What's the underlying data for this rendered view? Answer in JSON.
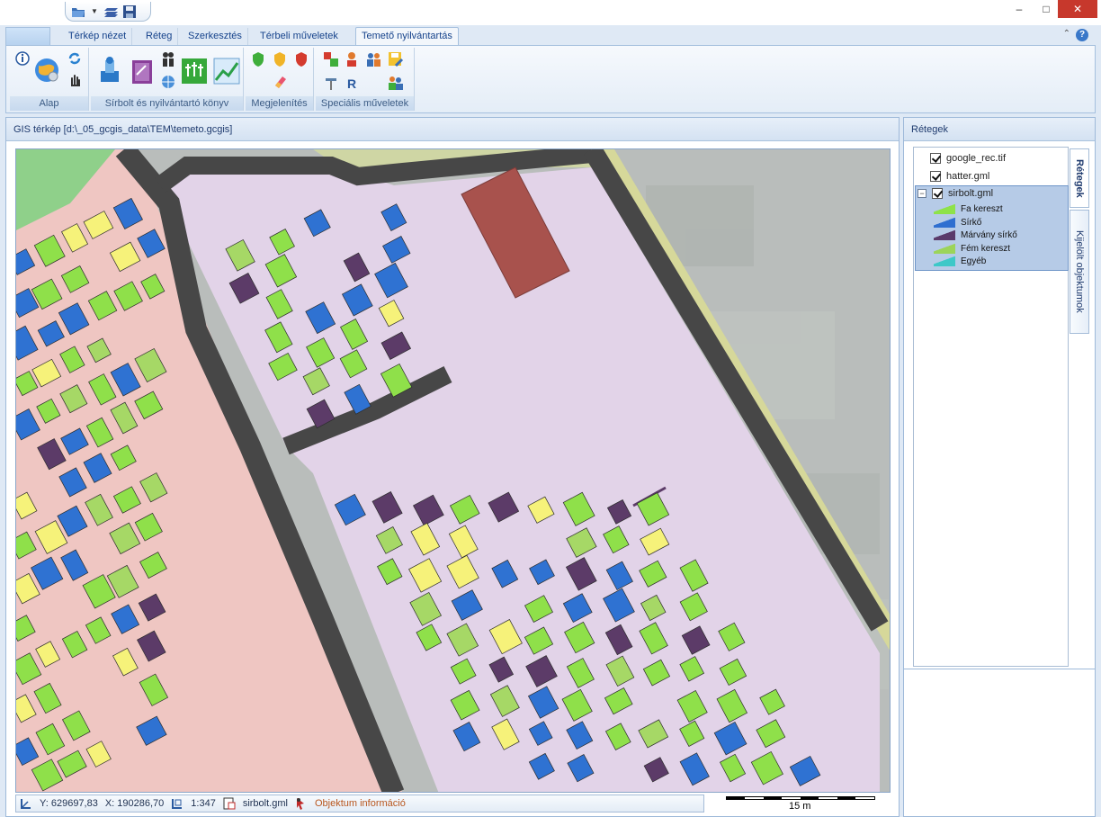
{
  "window": {
    "minimize": "–",
    "maximize": "□",
    "close": "✕"
  },
  "ribbon_tabs": [
    {
      "label": "Térkép nézet"
    },
    {
      "label": "Réteg"
    },
    {
      "label": "Szerkesztés"
    },
    {
      "label": "Térbeli műveletek"
    },
    {
      "label": "Temető nyilvántartás",
      "active": true
    }
  ],
  "ribbon_groups": [
    {
      "label": "Alap"
    },
    {
      "label": "Sírbolt és nyilvántartó könyv"
    },
    {
      "label": "Megjelenítés"
    },
    {
      "label": "Speciális műveletek"
    }
  ],
  "map_panel": {
    "title": "GIS térkép [d:\\_05_gcgis_data\\TEM\\temeto.gcgis]"
  },
  "status": {
    "y": "Y: 629697,83",
    "x": "X: 190286,70",
    "scale": "1:347",
    "layer": "sirbolt.gml",
    "tool": "Objektum információ"
  },
  "scalebar": {
    "label": "15 m"
  },
  "layers_panel": {
    "title": "Rétegek",
    "tab_layers": "Rétegek",
    "tab_selected": "Kijelölt objektumok",
    "layers": [
      {
        "name": "google_rec.tif",
        "checked": true
      },
      {
        "name": "hatter.gml",
        "checked": true
      },
      {
        "name": "sirbolt.gml",
        "checked": true
      }
    ],
    "legend": [
      {
        "label": "Fa kereszt",
        "color": "#8ee24a"
      },
      {
        "label": "Sírkő",
        "color": "#2f6fd0"
      },
      {
        "label": "Márvány sírkő",
        "color": "#5a3a6a"
      },
      {
        "label": "Fém kereszt",
        "color": "#9cd45a"
      },
      {
        "label": "Egyéb",
        "color": "#3ec8c8"
      }
    ]
  },
  "colors": {
    "grave_green": "#8fe04a",
    "grave_blue": "#2f72d2",
    "grave_yellow": "#f6f27a",
    "grave_purple": "#5c3b68",
    "grave_lightgreen": "#a6d866",
    "road": "#4a4a4a",
    "zone_pink": "#efc9c4",
    "zone_lilac": "#e4d4ea",
    "building": "#a7524f"
  }
}
